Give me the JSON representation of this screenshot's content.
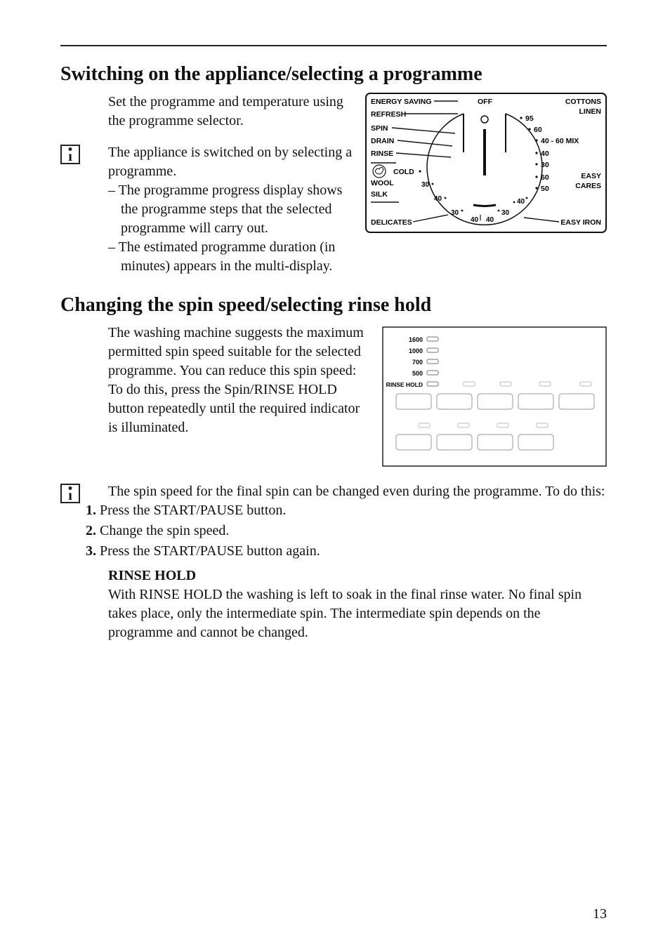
{
  "section1": {
    "title": "Switching on the appliance/selecting a programme",
    "intro": "Set the programme and temperature using the programme selector.",
    "info_para": "The appliance is switched on by selecting a programme.",
    "bullets": [
      "The programme progress display shows the programme steps that the selected programme will carry out.",
      "The estimated programme duration (in minutes) appears in the multi-display."
    ]
  },
  "selector": {
    "labels_left": [
      "ENERGY SAVING",
      "REFRESH",
      "SPIN",
      "DRAIN",
      "RINSE"
    ],
    "hand_icon_label": "COLD",
    "left_bottom": [
      "WOOL",
      "SILK"
    ],
    "bottom_left_label": "DELICATES",
    "top_center": "OFF",
    "right_top": [
      "COTTONS",
      "LINEN"
    ],
    "right_nums_top": [
      "95",
      "60",
      "40 - 60 MIX",
      "40",
      "30"
    ],
    "right_mid": [
      "60",
      "50"
    ],
    "right_mid_labels": [
      "EASY",
      "CARES"
    ],
    "bottom_right_label": "EASY IRON",
    "arc_nums": [
      "30",
      "40",
      "30",
      "40",
      "40",
      "30",
      "40"
    ]
  },
  "section2": {
    "title": "Changing the spin speed/selecting rinse hold",
    "para1": "The washing machine suggests the maximum permitted spin speed suitable for the selected programme. You can reduce this spin speed:",
    "para2": "To do this, press the Spin/RINSE HOLD button repeatedly until the required indicator is illuminated.",
    "info_para": "The spin speed for the final spin can be changed even during the programme. To do this:",
    "steps": [
      "Press the START/PAUSE button.",
      "Change the spin speed.",
      "Press the START/PAUSE button again."
    ],
    "rinse_head": "RINSE HOLD",
    "rinse_body": "With RINSE HOLD the washing is left to soak in the final rinse water. No final spin takes place, only the intermediate spin. The intermediate spin depends on the programme and cannot be changed."
  },
  "spin_panel": {
    "speeds": [
      "1600",
      "1000",
      "700",
      "500"
    ],
    "hold_label": "RINSE HOLD"
  },
  "page_number": "13"
}
